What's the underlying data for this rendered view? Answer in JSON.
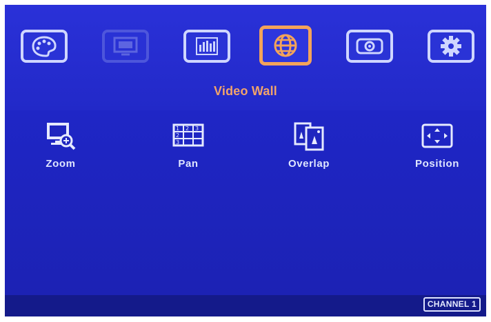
{
  "tabs": [
    {
      "name": "palette-icon",
      "state": "normal"
    },
    {
      "name": "screen-icon",
      "state": "disabled"
    },
    {
      "name": "equalizer-icon",
      "state": "normal"
    },
    {
      "name": "globe-icon",
      "state": "selected"
    },
    {
      "name": "projector-icon",
      "state": "normal"
    },
    {
      "name": "gear-icon",
      "state": "normal"
    }
  ],
  "section": {
    "title": "Video Wall"
  },
  "items": [
    {
      "label": "Zoom",
      "icon": "zoom-icon"
    },
    {
      "label": "Pan",
      "icon": "pan-grid-icon"
    },
    {
      "label": "Overlap",
      "icon": "overlap-icon"
    },
    {
      "label": "Position",
      "icon": "position-arrows-icon"
    }
  ],
  "status": {
    "channel": "CHANNEL 1"
  },
  "colors": {
    "background": "#1f26bf",
    "accent": "#f3a35a",
    "icon_outline": "#cfd6ff",
    "title": "#f2a46a"
  }
}
